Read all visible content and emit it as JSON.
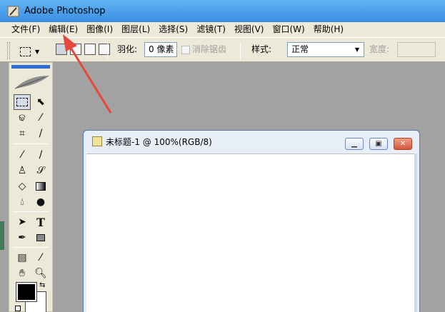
{
  "window": {
    "title": "Adobe Photoshop"
  },
  "menu": {
    "items": [
      "文件(F)",
      "编辑(E)",
      "图像(I)",
      "图层(L)",
      "选择(S)",
      "滤镜(T)",
      "视图(V)",
      "窗口(W)",
      "帮助(H)"
    ]
  },
  "options": {
    "feather_label": "羽化:",
    "feather_value": "0 像素",
    "antialias_label": "消除锯齿",
    "style_label": "样式:",
    "style_value": "正常",
    "width_label": "宽度:"
  },
  "document": {
    "title": "未标题-1 @ 100%(RGB/8)"
  },
  "colors": {
    "foreground": "#000000",
    "background": "#ffffff",
    "annotation": "#e8473b"
  }
}
